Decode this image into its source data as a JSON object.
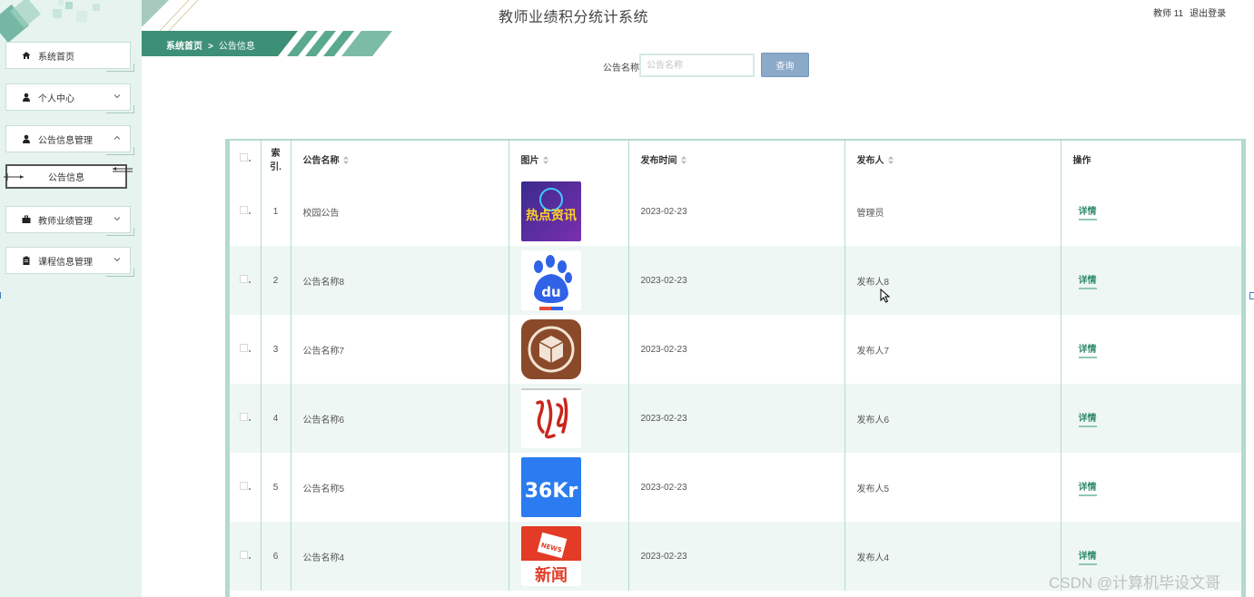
{
  "header": {
    "title": "教师业绩积分统计系统",
    "user_label": "教师 11",
    "logout_label": "退出登录"
  },
  "breadcrumb": {
    "home": "系统首页",
    "separator": ">",
    "current": "公告信息"
  },
  "sidebar": {
    "items": [
      {
        "label": "系统首页",
        "icon": "home-icon"
      },
      {
        "label": "个人中心",
        "icon": "user-icon"
      },
      {
        "label": "公告信息管理",
        "icon": "user-icon"
      },
      {
        "label": "教师业绩管理",
        "icon": "briefcase-icon"
      },
      {
        "label": "课程信息管理",
        "icon": "clipboard-icon"
      }
    ],
    "active_sub": "公告信息"
  },
  "search": {
    "label": "公告名称",
    "placeholder": "公告名称",
    "button": "查询"
  },
  "table": {
    "columns": [
      "索引",
      "公告名称",
      "图片",
      "发布时间",
      "发布人",
      "操作"
    ],
    "index_header_line1": "索",
    "index_header_line2": "引.",
    "action_label": "详情",
    "rows": [
      {
        "index": "1",
        "name": "校园公告",
        "image": "hot-news-logo",
        "time": "2023-02-23",
        "publisher": "管理员"
      },
      {
        "index": "2",
        "name": "公告名称8",
        "image": "baidu-logo",
        "time": "2023-02-23",
        "publisher": "发布人8"
      },
      {
        "index": "3",
        "name": "公告名称7",
        "image": "package-app-logo",
        "time": "2023-02-23",
        "publisher": "发布人7"
      },
      {
        "index": "4",
        "name": "公告名称6",
        "image": "calligraphy-logo",
        "time": "2023-02-23",
        "publisher": "发布人6"
      },
      {
        "index": "5",
        "name": "公告名称5",
        "image": "36kr-logo",
        "time": "2023-02-23",
        "publisher": "发布人5"
      },
      {
        "index": "6",
        "name": "公告名称4",
        "image": "news-app-logo",
        "time": "2023-02-23",
        "publisher": "发布人4"
      }
    ]
  },
  "logos": {
    "hot_news": "热点资讯",
    "baidu": "du",
    "kr": "36Kr",
    "news_big": "新闻",
    "news_small": "NEWS"
  },
  "watermark": "CSDN @计算机毕设文哥",
  "colors": {
    "sidebar_bg": "#e6f3ef",
    "accent_green": "#3d8f76",
    "table_border": "#b4dace",
    "search_button": "#8ba9c9",
    "link": "#2e8a6a"
  }
}
